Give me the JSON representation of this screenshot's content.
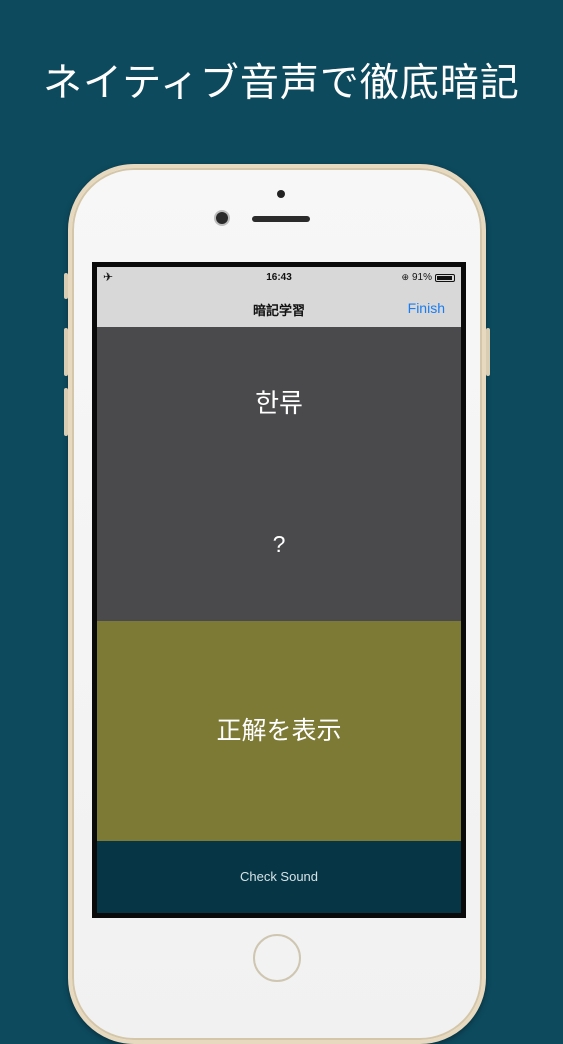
{
  "headline": "ネイティブ音声で徹底暗記",
  "status_bar": {
    "airplane_icon": "airplane-icon",
    "time": "16:43",
    "battery_percent": "91%",
    "battery_level": 0.91
  },
  "nav": {
    "title": "暗記学習",
    "finish_label": "Finish"
  },
  "card": {
    "word": "한류",
    "answer": "?"
  },
  "reveal_label": "正解を表示",
  "sound_label": "Check Sound",
  "colors": {
    "background": "#0d4a5e",
    "card_top": "#4a494c",
    "reveal": "#7d7a36",
    "sound": "#063646",
    "accent": "#1a7cf0"
  }
}
